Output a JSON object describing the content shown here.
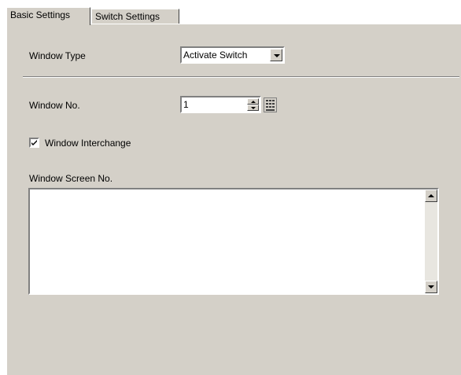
{
  "tabs": [
    {
      "label": "Basic Settings"
    },
    {
      "label": "Switch Settings"
    }
  ],
  "window_type": {
    "label": "Window Type",
    "value": "Activate Switch"
  },
  "window_no": {
    "label": "Window No.",
    "value": "1"
  },
  "window_interchange": {
    "label": "Window Interchange",
    "checked": true
  },
  "window_screen_no": {
    "label": "Window Screen No."
  },
  "icons": {
    "dropdown": "chevron-down-icon",
    "spin_up": "spin-up-icon",
    "spin_down": "spin-down-icon",
    "keypad": "keypad-icon",
    "checkmark": "checkmark-icon",
    "scroll_up": "scroll-up-icon",
    "scroll_down": "scroll-down-icon"
  },
  "colors": {
    "face": "#d4d0c8",
    "field": "#ffffff",
    "shadow": "#808080"
  }
}
